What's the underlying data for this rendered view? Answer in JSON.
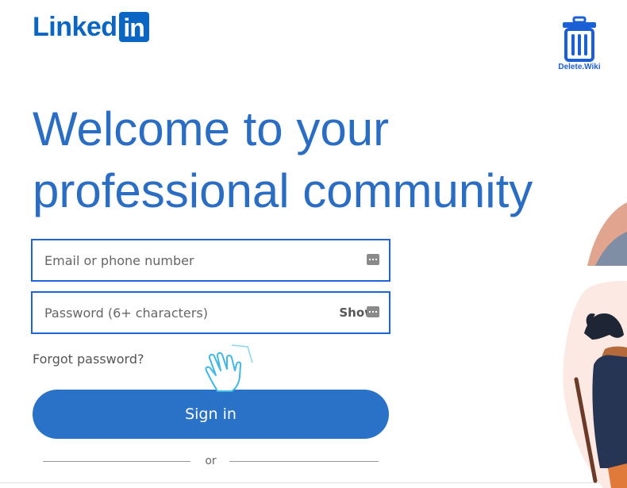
{
  "header": {
    "logo_text": "Linked",
    "logo_box_text": "in",
    "brand_color": "#0a66c2"
  },
  "trash_widget": {
    "icon": "trash-icon",
    "label": "Delete.Wiki",
    "color": "#1b5fd6"
  },
  "hero": {
    "headline_line1": "Welcome to your",
    "headline_line2": "professional community",
    "headline_color": "#2a6dc4"
  },
  "form": {
    "email_placeholder": "Email or phone number",
    "email_value": "",
    "password_placeholder": "Password (6+ characters)",
    "password_value": "",
    "show_label": "Show",
    "forgot_label": "Forgot password?",
    "signin_label": "Sign in",
    "or_label": "or",
    "field_border_color": "#1d64d8",
    "button_color": "#2a72c8"
  },
  "pointer": {
    "icon": "pointing-hand-cursor-icon"
  }
}
